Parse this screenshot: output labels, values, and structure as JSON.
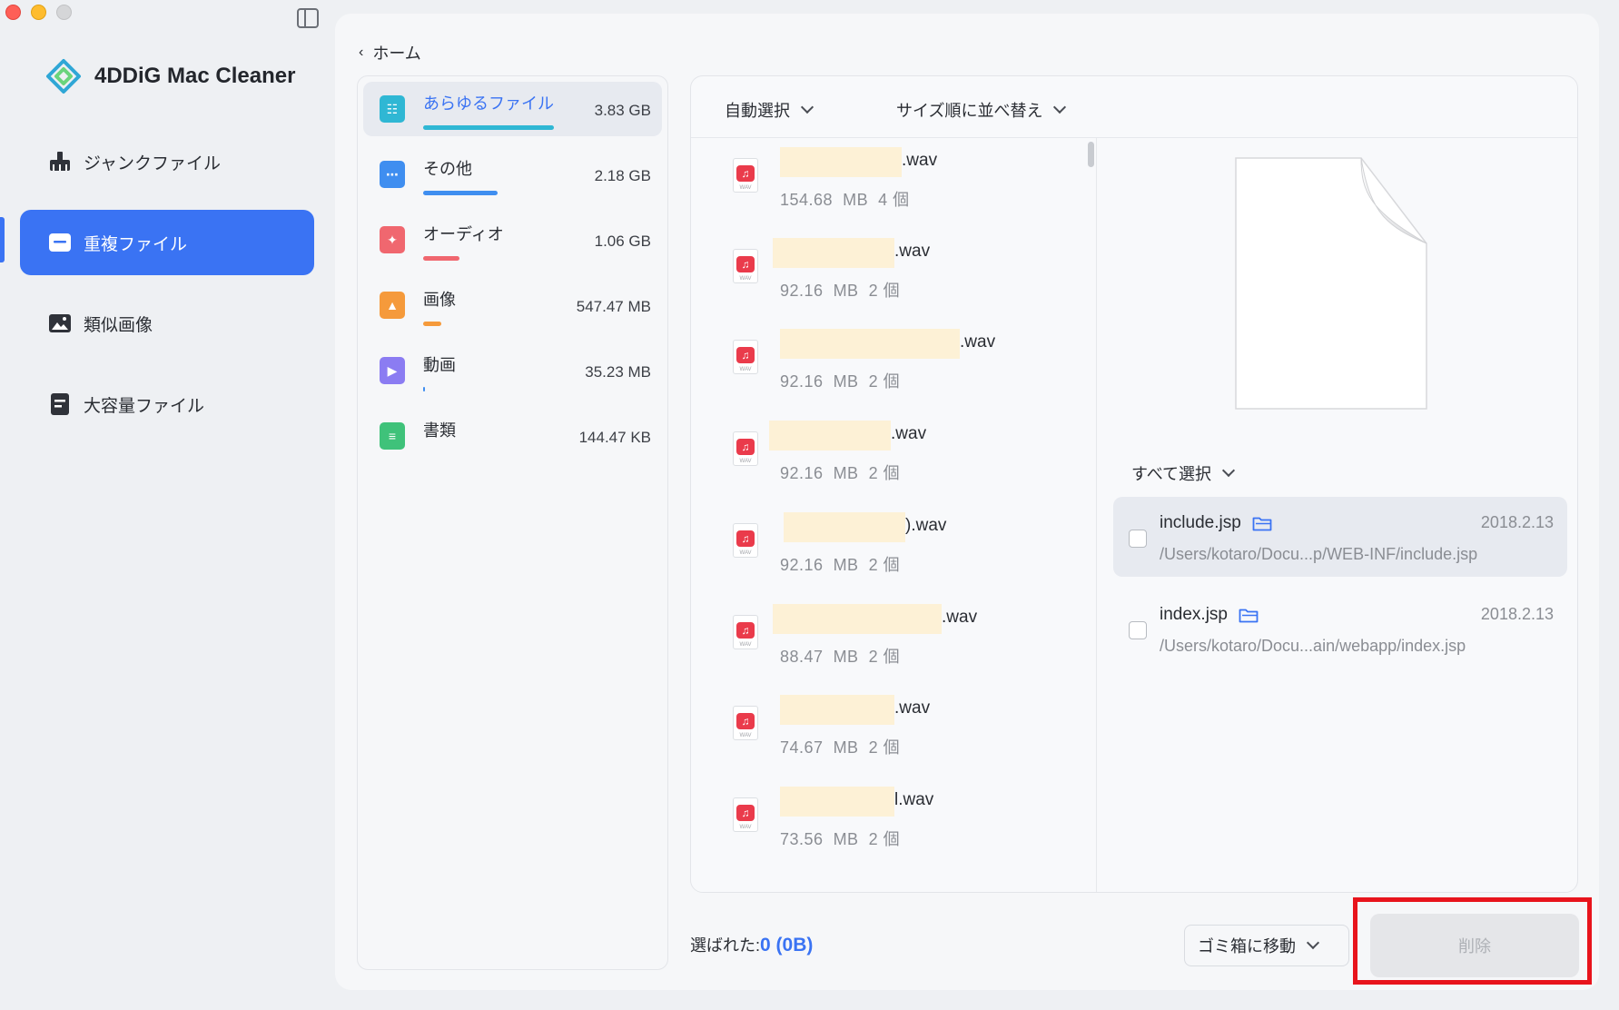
{
  "app": {
    "title": "4DDiG Mac Cleaner",
    "logo_colors": {
      "primary": "#2fa7d6",
      "secondary": "#6ad47c",
      "accent": "#3a73f3"
    }
  },
  "sidebar": {
    "items": [
      {
        "label": "ジャンクファイル",
        "icon": "broom-icon",
        "active": false
      },
      {
        "label": "重複ファイル",
        "icon": "duplicate-file-icon",
        "active": true
      },
      {
        "label": "類似画像",
        "icon": "image-icon",
        "active": false
      },
      {
        "label": "大容量ファイル",
        "icon": "large-file-icon",
        "active": false
      }
    ]
  },
  "header": {
    "back_label": "ホーム"
  },
  "categories": [
    {
      "name": "あらゆるファイル",
      "size": "3.83  GB",
      "color": "#2fb7d4",
      "icon": "all-files-icon",
      "active": true
    },
    {
      "name": "その他",
      "size": "2.18  GB",
      "color": "#3f8ef0",
      "icon": "other-icon",
      "active": false
    },
    {
      "name": "オーディオ",
      "size": "1.06  GB",
      "color": "#f0676f",
      "icon": "audio-icon",
      "active": false
    },
    {
      "name": "画像",
      "size": "547.47  MB",
      "color": "#f59a3b",
      "icon": "image-icon",
      "active": false
    },
    {
      "name": "動画",
      "size": "35.23  MB",
      "color": "#8b7cf2",
      "icon": "video-icon",
      "active": false
    },
    {
      "name": "書類",
      "size": "144.47  KB",
      "color": "#3fc27a",
      "icon": "document-icon",
      "active": false
    }
  ],
  "toolbar": {
    "auto_select_label": "自動選択",
    "sort_label": "サイズ順に並べ替え"
  },
  "files": [
    {
      "name_suffix": ".wav",
      "size": "154.68",
      "unit": "MB",
      "count": "4 個",
      "icon": "audio-file-icon"
    },
    {
      "name_suffix": ".wav",
      "size": "92.16",
      "unit": "MB",
      "count": "2 個",
      "icon": "audio-file-icon"
    },
    {
      "name_suffix": ".wav",
      "size": "92.16",
      "unit": "MB",
      "count": "2 個",
      "icon": "audio-file-icon"
    },
    {
      "name_suffix": ".wav",
      "size": "92.16",
      "unit": "MB",
      "count": "2 個",
      "icon": "audio-file-icon"
    },
    {
      "name_suffix": ").wav",
      "size": "92.16",
      "unit": "MB",
      "count": "2 個",
      "icon": "audio-file-icon"
    },
    {
      "name_suffix": ".wav",
      "size": "88.47",
      "unit": "MB",
      "count": "2 個",
      "icon": "audio-file-icon"
    },
    {
      "name_suffix": ".wav",
      "size": "74.67",
      "unit": "MB",
      "count": "2 個",
      "icon": "audio-file-icon"
    },
    {
      "name_suffix": "l.wav",
      "size": "73.56",
      "unit": "MB",
      "count": "2 個",
      "icon": "audio-file-icon"
    }
  ],
  "preview": {
    "select_all_label": "すべて選択",
    "duplicates": [
      {
        "name": "include.jsp",
        "date": "2018.2.13",
        "path": "/Users/kotaro/Docu...p/WEB-INF/include.jsp",
        "active": true
      },
      {
        "name": "index.jsp",
        "date": "2018.2.13",
        "path": "/Users/kotaro/Docu...ain/webapp/index.jsp",
        "active": false
      }
    ]
  },
  "footer": {
    "selected_label": "選ばれた:",
    "selected_value": "0 (0B)",
    "trash_label": "ゴミ箱に移動",
    "delete_label": "削除"
  }
}
